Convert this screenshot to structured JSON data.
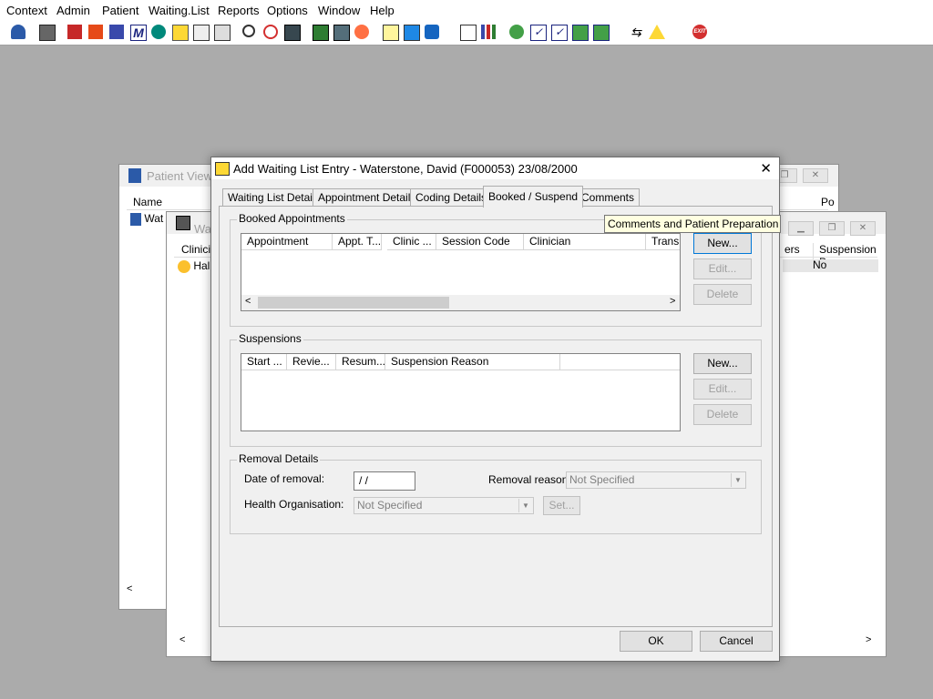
{
  "menu": [
    "Context",
    "Admin",
    "Patient",
    "Waiting.List",
    "Reports",
    "Options",
    "Window",
    "Help"
  ],
  "toolbar_icons": [
    "patient-icon",
    "print-icon",
    "book-icon",
    "edit-icon",
    "list-icon",
    "m-icon",
    "doctor-icon",
    "note-icon",
    "ambulance-icon",
    "ambulance2-icon",
    "search-icon",
    "clock-icon",
    "monitor-icon",
    "screen-icon",
    "card-icon",
    "dial-icon",
    "notepad-icon",
    "bed-icon",
    "transport-icon",
    "document-icon",
    "chart-icon",
    "globe-icon",
    "check-icon",
    "check2-icon",
    "download-icon",
    "swap-icon",
    "switch-icon",
    "warning-icon",
    "exit-icon"
  ],
  "exit_label": "EXIT",
  "bg_window1": {
    "title": "Patient View",
    "col_name": "Name",
    "col_po": "Po",
    "row": "Wat"
  },
  "bg_window2": {
    "title": "Wai",
    "col_clinician": "Clinicia",
    "row": "Hal",
    "col_ers": "ers",
    "col_suspension": "Suspension Pe",
    "value": "No"
  },
  "dialog": {
    "title": "Add Waiting List Entry - Waterstone, David (F000053) 23/08/2000",
    "close": "✕",
    "tabs": [
      "Waiting List Details",
      "Appointment Details",
      "Coding Details",
      "Booked / Suspend",
      "Comments"
    ],
    "active_tab": "Booked / Suspend",
    "booked": {
      "label": "Booked Appointments",
      "columns": [
        "Appointment",
        "Appt. T...",
        "Clinic ...",
        "Session Code",
        "Clinician",
        "Transp"
      ],
      "new": "New...",
      "edit": "Edit...",
      "delete": "Delete"
    },
    "suspensions": {
      "label": "Suspensions",
      "columns": [
        "Start ...",
        "Revie...",
        "Resum...",
        "Suspension Reason"
      ],
      "new": "New...",
      "edit": "Edit...",
      "delete": "Delete"
    },
    "removal": {
      "label": "Removal Details",
      "date_label": "Date of removal:",
      "date_value": " /  /",
      "reason_label": "Removal reason:",
      "reason_value": "Not Specified",
      "health_label": "Health Organisation:",
      "health_value": "Not Specified",
      "set": "Set..."
    },
    "ok": "OK",
    "cancel": "Cancel"
  },
  "tooltip": "Comments and Patient Preparation",
  "colors": {
    "accent": "#0078d7",
    "desktop": "#ababab",
    "dialog_bg": "#f0f0f0",
    "tooltip_bg": "#ffffe1"
  }
}
